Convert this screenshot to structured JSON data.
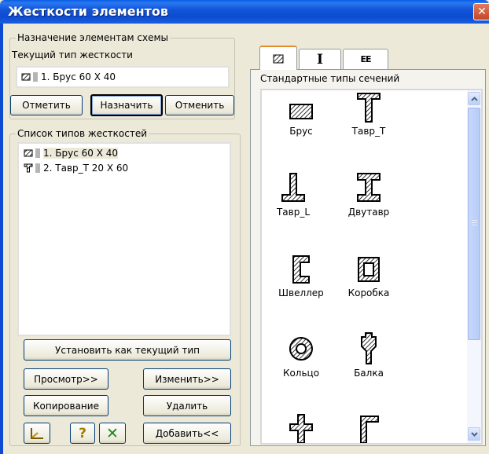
{
  "window": {
    "title": "Жесткости элементов",
    "close_label": "x"
  },
  "assign_group": {
    "legend": "Назначение элементам схемы",
    "current_type_label": "Текущий тип жесткости",
    "current_value": "1. Брус 60 X 40",
    "buttons": {
      "mark": "Отметить",
      "assign": "Назначить",
      "cancel": "Отменить"
    }
  },
  "types_list": {
    "legend": "Список типов жесткостей",
    "items": [
      {
        "label": "1. Брус 60 X 40",
        "icon": "rect-section-icon",
        "selected": true
      },
      {
        "label": "2. Тавр_Т 20 X 60",
        "icon": "tee-section-icon",
        "selected": false
      }
    ],
    "set_current_button": "Установить как текущий тип",
    "buttons": {
      "view": "Просмотр>>",
      "edit": "Изменить>>",
      "copy": "Копирование",
      "delete": "Удалить",
      "add": "Добавить<<"
    },
    "tools": [
      "chart-axis-icon",
      "help-icon",
      "cancel-x-icon"
    ]
  },
  "right_panel": {
    "tabs": [
      {
        "icon": "rect-section-icon",
        "active": true
      },
      {
        "icon": "i-beam-icon",
        "active": false
      },
      {
        "icon": "ee-icon",
        "active": false
      }
    ],
    "subtitle": "Стандартные типы сечений",
    "sections": [
      {
        "label": "Брус",
        "icon": "rect-section-icon"
      },
      {
        "label": "Тавр_Т",
        "icon": "tee-t-icon"
      },
      {
        "label": "Тавр_L",
        "icon": "tee-l-icon"
      },
      {
        "label": "Двутавр",
        "icon": "i-beam-icon"
      },
      {
        "label": "Швеллер",
        "icon": "channel-icon"
      },
      {
        "label": "Коробка",
        "icon": "box-icon"
      },
      {
        "label": "Кольцо",
        "icon": "ring-icon"
      },
      {
        "label": "Балка",
        "icon": "beam-icon"
      },
      {
        "label": "",
        "icon": "cross-icon"
      },
      {
        "label": "",
        "icon": "angle-icon"
      }
    ]
  },
  "colors": {
    "title_bar": "#0c4bd0",
    "dialog_bg": "#ece9d8",
    "accent_tab": "#e68b2c"
  }
}
